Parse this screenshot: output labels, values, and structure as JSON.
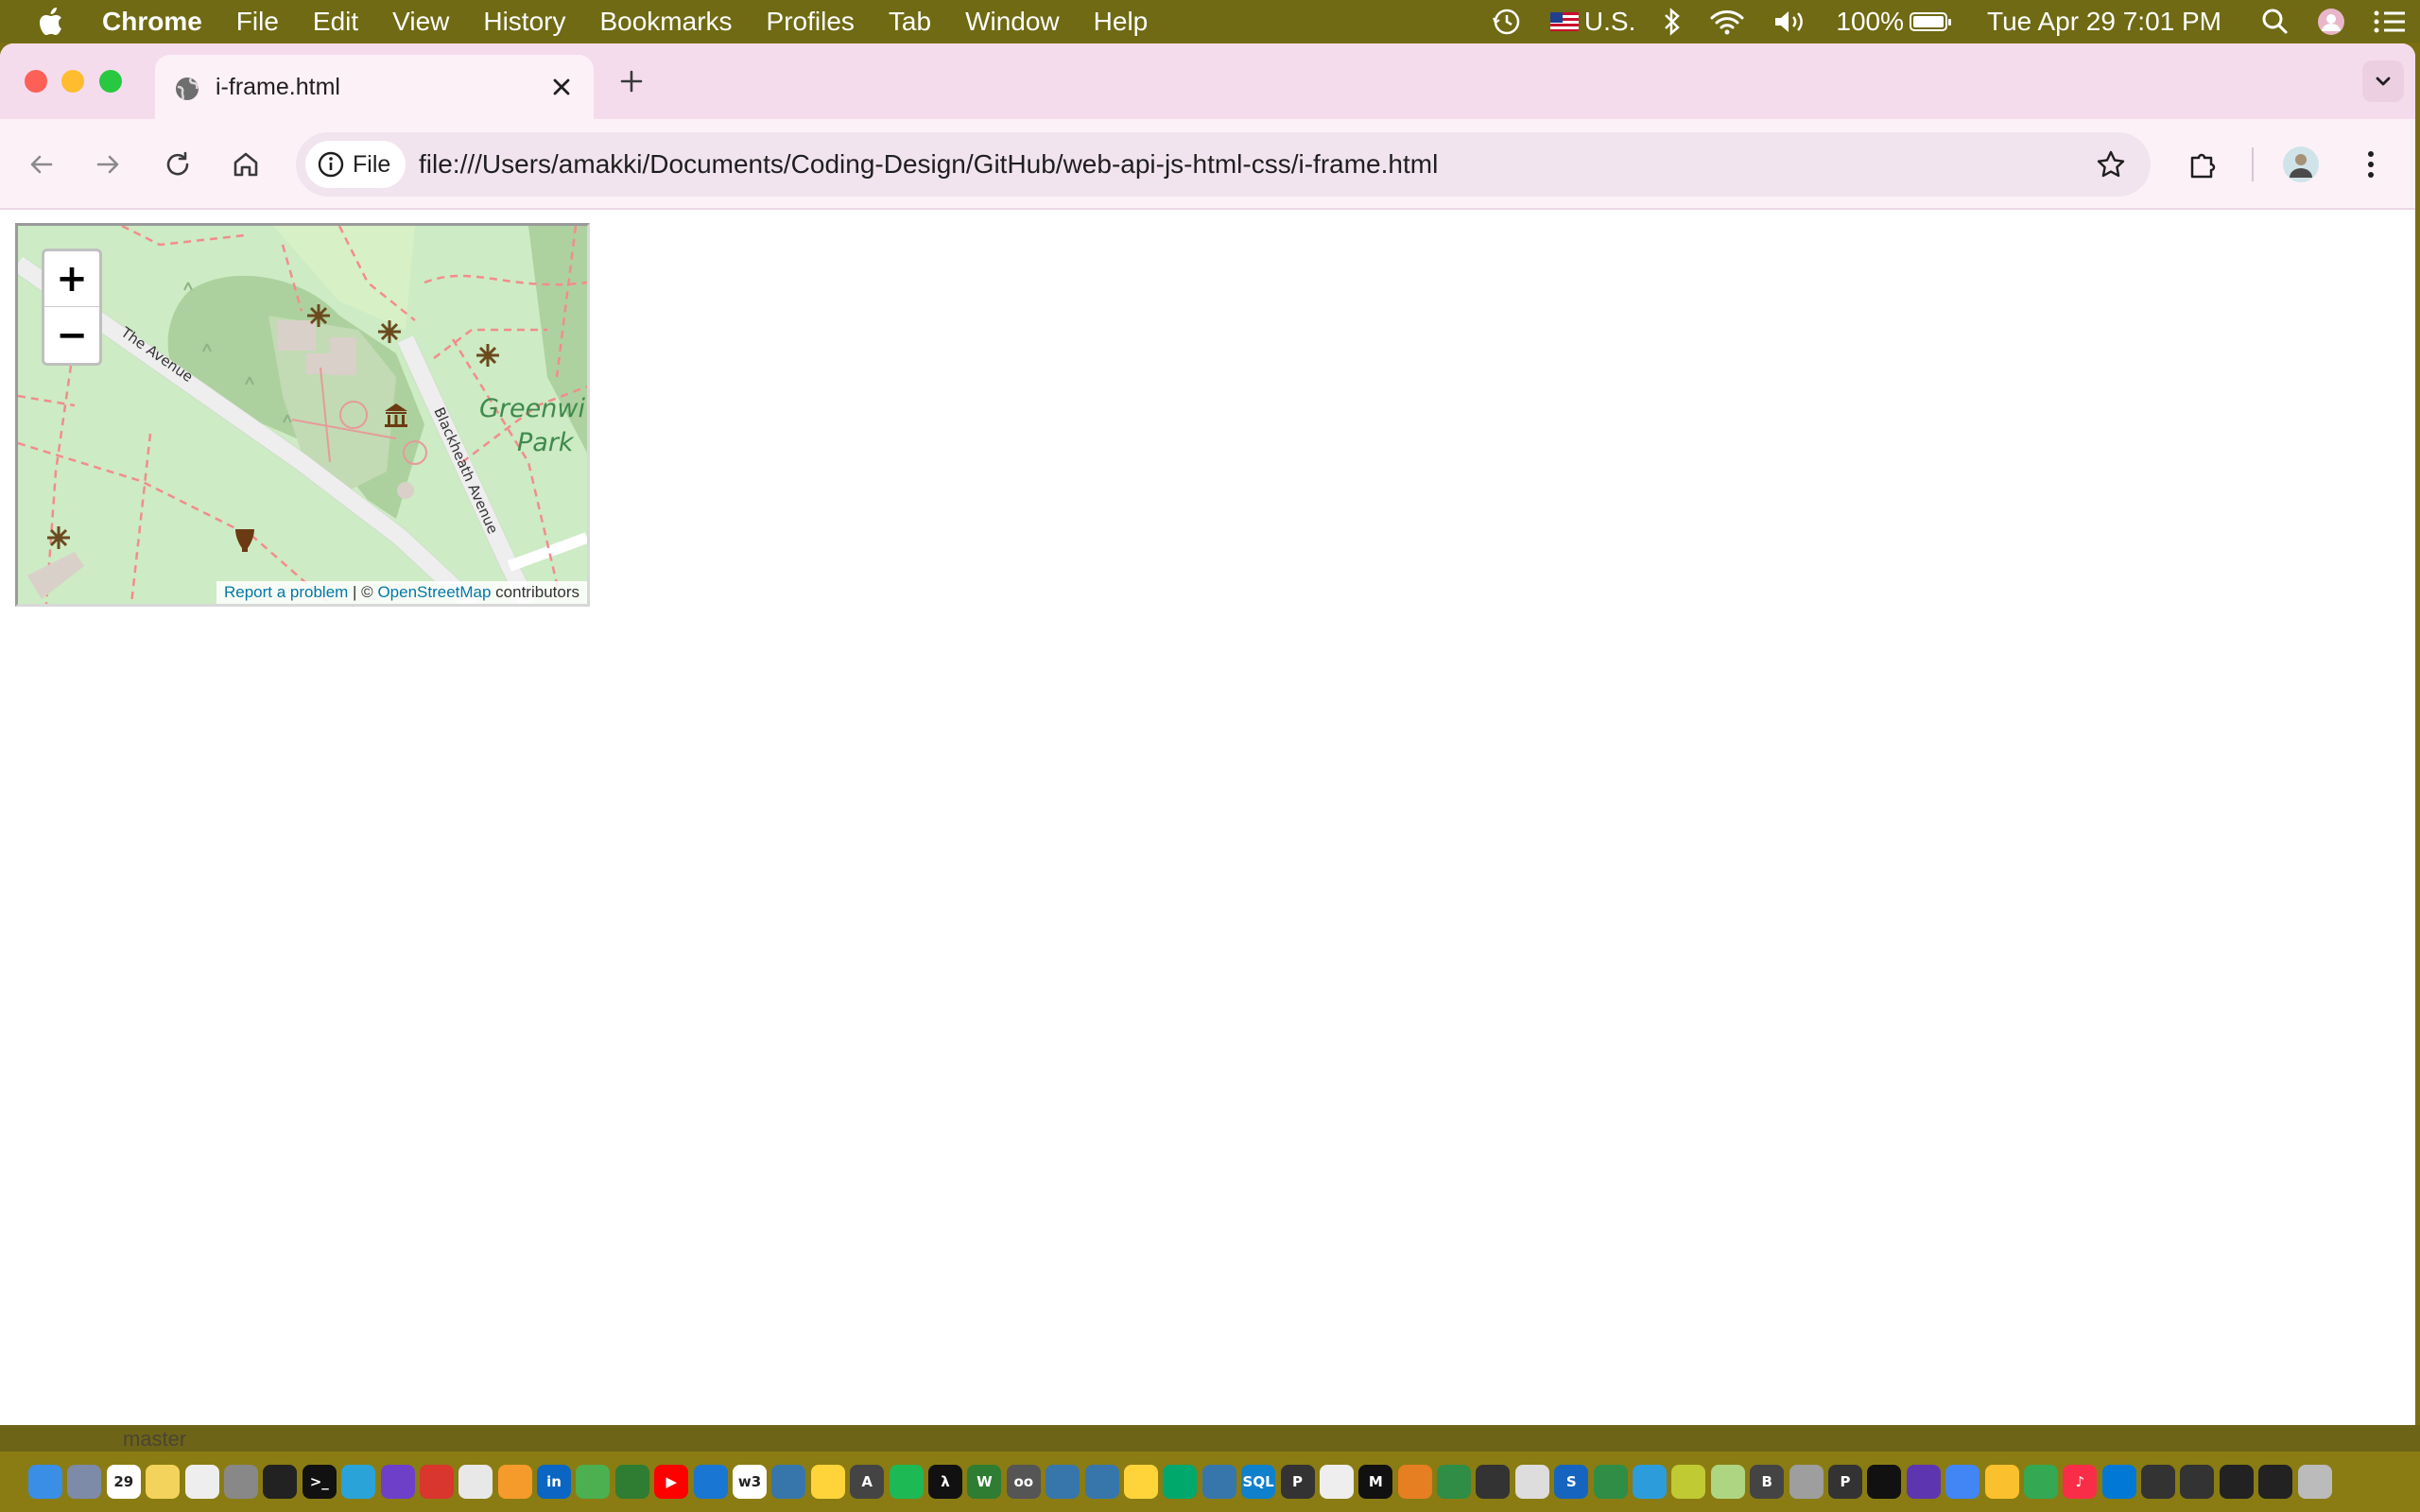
{
  "menubar": {
    "app_name": "Chrome",
    "items": [
      "File",
      "Edit",
      "View",
      "History",
      "Bookmarks",
      "Profiles",
      "Tab",
      "Window",
      "Help"
    ],
    "input_source": "U.S.",
    "battery": "100%",
    "datetime": "Tue Apr 29  7:01 PM"
  },
  "tab": {
    "title": "i-frame.html"
  },
  "toolbar": {
    "site_chip": "File",
    "url": "file:///Users/amakki/Documents/Coding-Design/GitHub/web-api-js-html-css/i-frame.html"
  },
  "map": {
    "zoom_in": "+",
    "zoom_out": "−",
    "labels": {
      "road1": "The Avenue",
      "road2": "Blackheath Avenue",
      "park_line1": "Greenwi",
      "park_line2": "Park"
    },
    "attribution": {
      "report": "Report a problem",
      "sep": " | © ",
      "osm": "OpenStreetMap",
      "suffix": " contributors"
    }
  },
  "behind": {
    "branch": "master"
  },
  "dock": {
    "apps": [
      {
        "name": "finder",
        "color": "#3a8ee6",
        "glyph": ""
      },
      {
        "name": "launchpad",
        "color": "#7d8aa8",
        "glyph": ""
      },
      {
        "name": "calendar",
        "color": "#ffffff",
        "glyph": "29"
      },
      {
        "name": "notes",
        "color": "#f3d35b",
        "glyph": ""
      },
      {
        "name": "preview",
        "color": "#eeeeee",
        "glyph": ""
      },
      {
        "name": "system-settings",
        "color": "#888888",
        "glyph": ""
      },
      {
        "name": "github",
        "color": "#222222",
        "glyph": ""
      },
      {
        "name": "terminal",
        "color": "#111111",
        "glyph": ">_"
      },
      {
        "name": "edge",
        "color": "#2aa3d8",
        "glyph": ""
      },
      {
        "name": "github-desktop",
        "color": "#6e40c9",
        "glyph": ""
      },
      {
        "name": "app-red",
        "color": "#d9362e",
        "glyph": ""
      },
      {
        "name": "chrome",
        "color": "#e8e8e8",
        "glyph": ""
      },
      {
        "name": "app-orange",
        "color": "#f59b2b",
        "glyph": ""
      },
      {
        "name": "linkedin",
        "color": "#0a66c2",
        "glyph": "in"
      },
      {
        "name": "app-multi",
        "color": "#4caf50",
        "glyph": ""
      },
      {
        "name": "app-green",
        "color": "#2e7d32",
        "glyph": ""
      },
      {
        "name": "youtube",
        "color": "#ff0000",
        "glyph": "▶"
      },
      {
        "name": "app-blue",
        "color": "#1976d2",
        "glyph": ""
      },
      {
        "name": "w3schools",
        "color": "#ffffff",
        "glyph": "w3"
      },
      {
        "name": "python",
        "color": "#3776ab",
        "glyph": ""
      },
      {
        "name": "python-2",
        "color": "#ffd43b",
        "glyph": ""
      },
      {
        "name": "app-a",
        "color": "#444444",
        "glyph": "A"
      },
      {
        "name": "app-cursor",
        "color": "#1db954",
        "glyph": ""
      },
      {
        "name": "app-lambda",
        "color": "#111111",
        "glyph": "λ"
      },
      {
        "name": "app-w",
        "color": "#2e7d32",
        "glyph": "W"
      },
      {
        "name": "app-oo",
        "color": "#555555",
        "glyph": "oo"
      },
      {
        "name": "python-3",
        "color": "#3776ab",
        "glyph": ""
      },
      {
        "name": "python-4",
        "color": "#3776ab",
        "glyph": ""
      },
      {
        "name": "python-5",
        "color": "#ffd43b",
        "glyph": ""
      },
      {
        "name": "app-c",
        "color": "#00a86b",
        "glyph": ""
      },
      {
        "name": "python-6",
        "color": "#3776ab",
        "glyph": ""
      },
      {
        "name": "sqlite",
        "color": "#0f80cc",
        "glyph": "SQL"
      },
      {
        "name": "app-p",
        "color": "#333333",
        "glyph": "P"
      },
      {
        "name": "app-pen",
        "color": "#eeeeee",
        "glyph": ""
      },
      {
        "name": "app-m",
        "color": "#111111",
        "glyph": "M"
      },
      {
        "name": "app-ring",
        "color": "#e67e22",
        "glyph": ""
      },
      {
        "name": "geeks",
        "color": "#2f8d46",
        "glyph": ""
      },
      {
        "name": "app-bar",
        "color": "#333333",
        "glyph": ""
      },
      {
        "name": "safari",
        "color": "#dddddd",
        "glyph": ""
      },
      {
        "name": "app-s",
        "color": "#1565c0",
        "glyph": "S"
      },
      {
        "name": "geeks-2",
        "color": "#2f8d46",
        "glyph": ""
      },
      {
        "name": "app-cube",
        "color": "#2d9cdb",
        "glyph": ""
      },
      {
        "name": "app-frog",
        "color": "#c0ca33",
        "glyph": ""
      },
      {
        "name": "app-frog-2",
        "color": "#aed581",
        "glyph": ""
      },
      {
        "name": "app-b",
        "color": "#444444",
        "glyph": "B"
      },
      {
        "name": "app-circle",
        "color": "#9e9e9e",
        "glyph": ""
      },
      {
        "name": "app-p2",
        "color": "#333333",
        "glyph": "P"
      },
      {
        "name": "app-bars",
        "color": "#111111",
        "glyph": ""
      },
      {
        "name": "app-purple",
        "color": "#5e35b1",
        "glyph": ""
      },
      {
        "name": "docs",
        "color": "#4285f4",
        "glyph": ""
      },
      {
        "name": "app-yellow",
        "color": "#fbc02d",
        "glyph": ""
      },
      {
        "name": "drive",
        "color": "#34a853",
        "glyph": ""
      },
      {
        "name": "music",
        "color": "#fa2d48",
        "glyph": "♪"
      },
      {
        "name": "vscode",
        "color": "#0078d4",
        "glyph": ""
      },
      {
        "name": "folder-1",
        "color": "#333333",
        "glyph": ""
      },
      {
        "name": "folder-2",
        "color": "#333333",
        "glyph": ""
      },
      {
        "name": "folder-3",
        "color": "#222222",
        "glyph": ""
      },
      {
        "name": "folder-4",
        "color": "#222222",
        "glyph": ""
      },
      {
        "name": "trash",
        "color": "#bbbbbb",
        "glyph": ""
      }
    ]
  },
  "colors": {
    "desktop": "#7a6e10",
    "tabstrip": "#f5dced",
    "toolbar": "#fdf1f8",
    "map_park": "#cdebc4",
    "map_link": "#0078a8"
  }
}
